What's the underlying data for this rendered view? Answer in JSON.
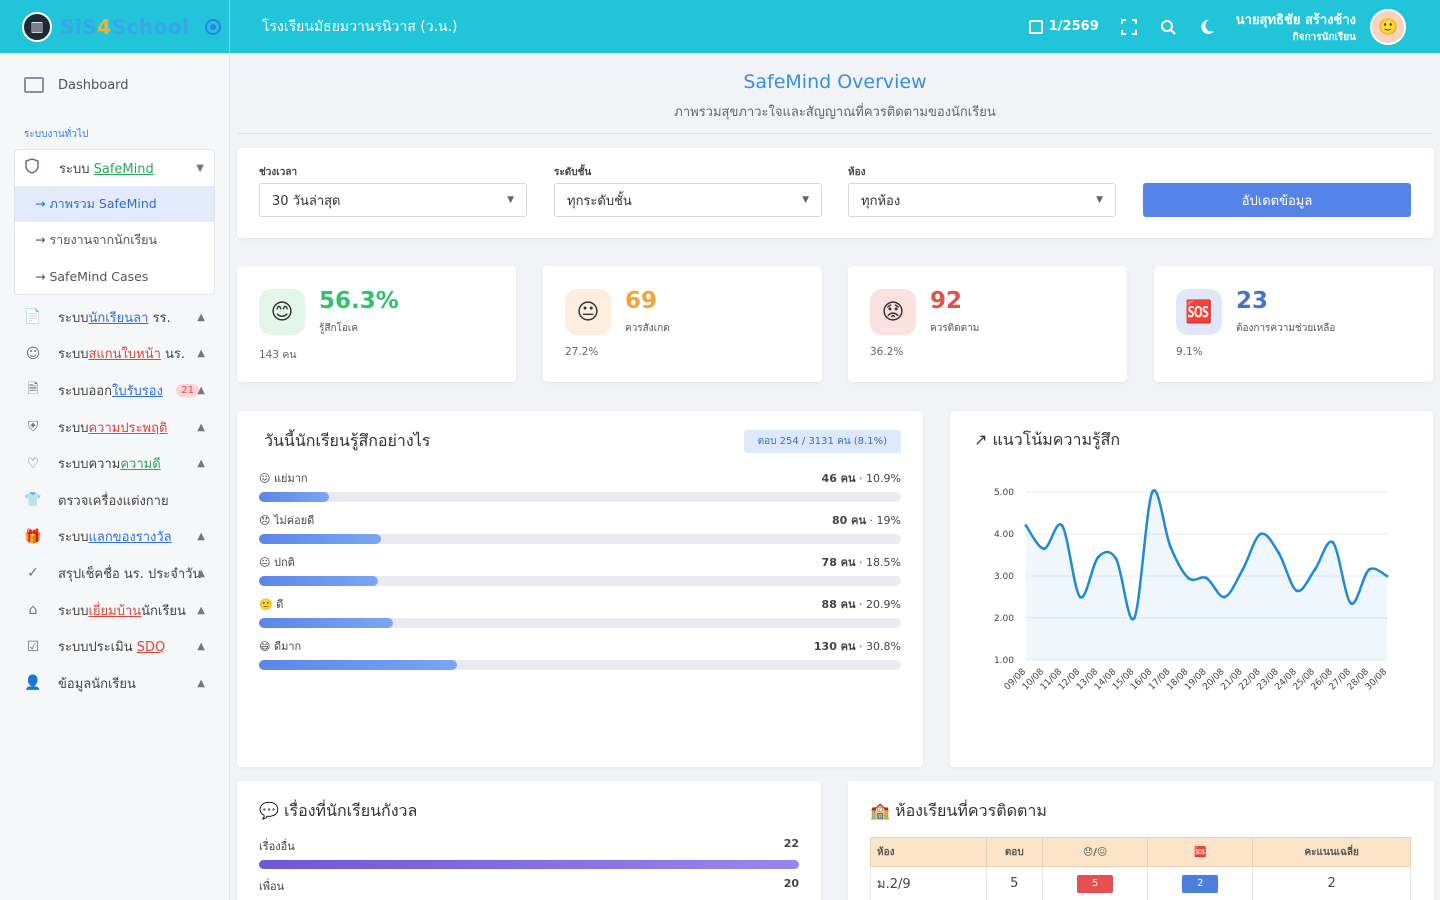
{
  "brand": {
    "name_prefix": "SiS",
    "name_four": "4",
    "name_suffix": "School"
  },
  "topbar": {
    "school": "โรงเรียนมัธยมวานรนิวาส (ว.น.)",
    "term": "1/2569",
    "user_name": "นายสุทธิชัย สร้างช้าง",
    "user_role": "กิจการนักเรียน"
  },
  "sidebar": {
    "dashboard": "Dashboard",
    "section": "ระบบงานทั่วไป",
    "group": {
      "label_prefix": "ระบบ ",
      "label_hl": "SafeMind",
      "sub_items": [
        "→ ภาพรวม SafeMind",
        "→ รายงานจากนักเรียน",
        "→ SafeMind Cases"
      ]
    },
    "items": [
      {
        "pre": "ระบบ",
        "hl": "นักเรียนลา",
        "post": " รร.",
        "hl_color": "blue",
        "icon": "file-user-icon"
      },
      {
        "pre": "ระบบ",
        "hl": "สแกนใบหน้า",
        "post": " นร.",
        "hl_color": "red",
        "icon": "face-scan-icon"
      },
      {
        "pre": "ระบบออก",
        "hl": "ใบรับรอง",
        "post": "",
        "hl_color": "blue",
        "icon": "document-icon",
        "badge": "21"
      },
      {
        "pre": "ระบบ",
        "hl": "ความประพฤติ",
        "post": "",
        "hl_color": "red",
        "icon": "shield-icon"
      },
      {
        "pre": "ระบบความ",
        "hl": "ความดี",
        "post": "",
        "hl_color": "green",
        "icon": "heart-icon"
      },
      {
        "pre": "ตรวจเครื่องแต่งกาย",
        "hl": "",
        "post": "",
        "hl_color": "",
        "icon": "shirt-icon"
      },
      {
        "pre": "ระบบ",
        "hl": "แลกของรางวัล",
        "post": "",
        "hl_color": "blue",
        "icon": "gift-icon"
      },
      {
        "pre": "สรุปเช็คชื่อ นร. ประจำวัน",
        "hl": "",
        "post": "",
        "hl_color": "",
        "icon": "check-circle-icon"
      },
      {
        "pre": "ระบบ",
        "hl": "เยี่ยมบ้าน",
        "post": "นักเรียน",
        "hl_color": "red",
        "icon": "home-icon"
      },
      {
        "pre": "ระบบประเมิน ",
        "hl": "SDQ",
        "post": "",
        "hl_color": "red",
        "icon": "checklist-icon"
      },
      {
        "pre": "ข้อมูลนักเรียน",
        "hl": "",
        "post": "",
        "hl_color": "",
        "icon": "user-icon"
      }
    ]
  },
  "header": {
    "title": "SafeMind Overview",
    "subtitle": "ภาพรวมสุขภาวะใจและสัญญาณที่ควรติดตามของนักเรียน"
  },
  "filters": {
    "period_label": "ช่วงเวลา",
    "period_value": "30 วันล่าสุด",
    "level_label": "ระดับชั้น",
    "level_value": "ทุกระดับชั้น",
    "room_label": "ห้อง",
    "room_value": "ทุกห้อง",
    "update_label": "อัปเดตข้อมูล"
  },
  "stats": [
    {
      "emoji": "😊",
      "value": "56.3%",
      "label": "รู้สึกโอเค",
      "foot": "143 คน",
      "color": "#2ec26a",
      "bg": "#e3f6ea"
    },
    {
      "emoji": "😐",
      "value": "69",
      "label": "ควรสังเกต",
      "foot": "27.2%",
      "color": "#f2a33a",
      "bg": "#fdeedd"
    },
    {
      "emoji": "😟",
      "value": "92",
      "label": "ควรติดตาม",
      "foot": "36.2%",
      "color": "#e0524a",
      "bg": "#fbe1df"
    },
    {
      "emoji": "🆘",
      "value": "23",
      "label": "ต้องการความช่วยเหลือ",
      "foot": "9.1%",
      "color": "#4a73c8",
      "bg": "#e0e8f8"
    }
  ],
  "feelings": {
    "title": "วันนี้นักเรียนรู้สึกอย่างไร",
    "response": "ตอบ 254 / 3131 คน (8.1%)",
    "rows": [
      {
        "label": "😖 แย่มาก",
        "count": "46 คน",
        "pct_text": " · 10.9%",
        "fraction": 0.109
      },
      {
        "label": "😞 ไม่ค่อยดี",
        "count": "80 คน",
        "pct_text": " · 19%",
        "fraction": 0.19
      },
      {
        "label": "😐 ปกติ",
        "count": "78 คน",
        "pct_text": " · 18.5%",
        "fraction": 0.185
      },
      {
        "label": "🙂 ดี",
        "count": "88 คน",
        "pct_text": " · 20.9%",
        "fraction": 0.209
      },
      {
        "label": "😄 ดีมาก",
        "count": "130 คน",
        "pct_text": " · 30.8%",
        "fraction": 0.308
      }
    ]
  },
  "chart_data": {
    "type": "line",
    "title": "แนวโน้มความรู้สึก",
    "xlabel": "",
    "ylabel": "",
    "ylim": [
      1,
      5
    ],
    "y_ticks": [
      "1.00",
      "2.00",
      "3.00",
      "4.00",
      "5.00"
    ],
    "grid": true,
    "x": [
      "09/08",
      "10/08",
      "11/08",
      "12/08",
      "13/08",
      "14/08",
      "15/08",
      "16/08",
      "17/08",
      "18/08",
      "19/08",
      "20/08",
      "21/08",
      "22/08",
      "23/08",
      "24/08",
      "25/08",
      "26/08",
      "27/08",
      "28/08",
      "30/08"
    ],
    "series": [
      {
        "values": [
          4.2,
          3.65,
          4.2,
          2.5,
          3.45,
          3.4,
          2.0,
          5.0,
          3.7,
          2.95,
          2.95,
          2.5,
          3.15,
          4.0,
          3.55,
          2.65,
          3.15,
          3.8,
          2.35,
          3.15,
          3.0
        ]
      }
    ]
  },
  "worries": {
    "title": "เรื่องที่นักเรียนกังวล",
    "max": 22,
    "rows": [
      {
        "label": "เรื่องอื่น",
        "count": "22",
        "value": 22
      },
      {
        "label": "เพื่อน",
        "count": "20",
        "value": 20
      }
    ]
  },
  "rooms": {
    "title": "ห้องเรียนที่ควรติดตาม",
    "headers": [
      "ห้อง",
      "ตอบ",
      "😞/😖",
      "🆘",
      "คะแนนเฉลี่ย"
    ],
    "rows": [
      {
        "room": "ม.2/9",
        "responses": "5",
        "low": "5",
        "sos": "2",
        "avg": "2"
      }
    ]
  },
  "colors": {
    "topbar": "#21c4d8",
    "accent": "#5584e8",
    "title": "#3a8fdd"
  }
}
